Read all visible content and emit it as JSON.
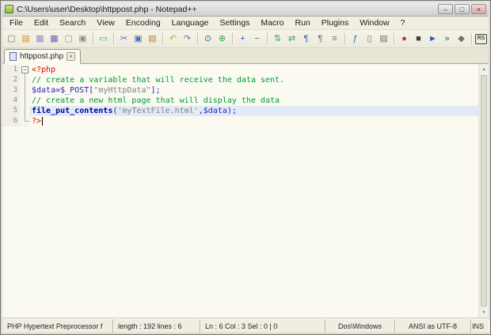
{
  "window": {
    "title": "C:\\Users\\user\\Desktop\\httppost.php - Notepad++",
    "controls": {
      "minimize": "–",
      "maximize": "□",
      "close": "×"
    }
  },
  "menu": {
    "items": [
      "File",
      "Edit",
      "Search",
      "View",
      "Encoding",
      "Language",
      "Settings",
      "Macro",
      "Run",
      "Plugins",
      "Window",
      "?"
    ]
  },
  "toolbar": {
    "icons": [
      {
        "name": "new-file",
        "glyph": "▢",
        "color": "#6f6f6f"
      },
      {
        "name": "open-folder",
        "glyph": "▤",
        "color": "#c89630"
      },
      {
        "name": "save",
        "glyph": "▦",
        "color": "#9a86c8"
      },
      {
        "name": "save-all",
        "glyph": "▦",
        "color": "#6f5fb0"
      },
      {
        "name": "close-file",
        "glyph": "▢",
        "color": "#8f8f8f"
      },
      {
        "name": "close-all-files",
        "glyph": "▣",
        "color": "#8f8f8f"
      },
      {
        "sep": true
      },
      {
        "name": "print",
        "glyph": "▭",
        "color": "#3f9f9f"
      },
      {
        "sep": true
      },
      {
        "name": "cut",
        "glyph": "✂",
        "color": "#4a70b8"
      },
      {
        "name": "copy",
        "glyph": "▣",
        "color": "#4a70b8"
      },
      {
        "name": "paste",
        "glyph": "▤",
        "color": "#b08838"
      },
      {
        "sep": true
      },
      {
        "name": "undo",
        "glyph": "↶",
        "color": "#d0a020"
      },
      {
        "name": "redo",
        "glyph": "↷",
        "color": "#8868c0"
      },
      {
        "sep": true
      },
      {
        "name": "find",
        "glyph": "⊙",
        "color": "#3868b0"
      },
      {
        "name": "replace",
        "glyph": "⊕",
        "color": "#38a068"
      },
      {
        "sep": true
      },
      {
        "name": "zoom-in",
        "glyph": "+",
        "color": "#3868b0"
      },
      {
        "name": "zoom-out",
        "glyph": "−",
        "color": "#3868b0"
      },
      {
        "sep": true
      },
      {
        "name": "sync-vertical-scroll",
        "glyph": "⇅",
        "color": "#3f9f9f"
      },
      {
        "name": "sync-horizontal-scroll",
        "glyph": "⇄",
        "color": "#3f9f9f"
      },
      {
        "name": "word-wrap",
        "glyph": "¶",
        "color": "#3868b0"
      },
      {
        "name": "show-all-characters",
        "glyph": "¶",
        "color": "#707070"
      },
      {
        "name": "show-indent-guide",
        "glyph": "≡",
        "color": "#707070"
      },
      {
        "sep": true
      },
      {
        "name": "function-list",
        "glyph": "ƒ",
        "color": "#3868b0"
      },
      {
        "name": "document-map",
        "glyph": "▯",
        "color": "#707070"
      },
      {
        "name": "document-list",
        "glyph": "▤",
        "color": "#707070"
      },
      {
        "sep": true
      },
      {
        "name": "macro-record",
        "glyph": "●",
        "color": "#c03030"
      },
      {
        "name": "macro-stop",
        "glyph": "■",
        "color": "#404040"
      },
      {
        "name": "macro-play",
        "glyph": "►",
        "color": "#2858b8"
      },
      {
        "name": "macro-run-multiple",
        "glyph": "»",
        "color": "#2858b8"
      },
      {
        "name": "macro-save",
        "glyph": "◆",
        "color": "#707070"
      },
      {
        "sep": true
      },
      {
        "name": "plugin-rs",
        "glyph": "RS",
        "color": "#404040"
      },
      {
        "name": "plugin-doc",
        "glyph": "▣",
        "color": "#3868b0"
      }
    ]
  },
  "tabbar": {
    "tabs": [
      {
        "label": "httppost.php",
        "active": true
      }
    ]
  },
  "editor": {
    "lines": [
      {
        "number": 1,
        "fold": "start",
        "tokens": [
          {
            "t": "<?php",
            "c": "phptag"
          }
        ]
      },
      {
        "number": 2,
        "fold": "mid",
        "tokens": [
          {
            "t": "// create a variable that will receive the data sent.",
            "c": "comment"
          }
        ]
      },
      {
        "number": 3,
        "fold": "mid",
        "tokens": [
          {
            "t": "$data",
            "c": "var"
          },
          {
            "t": "=",
            "c": "op"
          },
          {
            "t": "$_POST",
            "c": "var"
          },
          {
            "t": "[",
            "c": "op"
          },
          {
            "t": "\"myHttpData\"",
            "c": "string"
          },
          {
            "t": "];",
            "c": "op"
          }
        ]
      },
      {
        "number": 4,
        "fold": "mid",
        "tokens": [
          {
            "t": "// create a new html page that will display the data",
            "c": "comment"
          }
        ]
      },
      {
        "number": 5,
        "fold": "mid",
        "highlight": true,
        "tokens": [
          {
            "t": "file_put_contents",
            "c": "func"
          },
          {
            "t": "(",
            "c": "op"
          },
          {
            "t": "'myTextFile.html'",
            "c": "string"
          },
          {
            "t": ",",
            "c": "op"
          },
          {
            "t": "$data",
            "c": "var"
          },
          {
            "t": ");",
            "c": "op"
          }
        ]
      },
      {
        "number": 6,
        "fold": "end",
        "caret": true,
        "tokens": [
          {
            "t": "?>",
            "c": "phptag"
          }
        ]
      }
    ]
  },
  "statusbar": {
    "doctype": "PHP Hypertext Preprocessor f",
    "length_lines": "length : 192    lines : 6",
    "position": "Ln : 6    Col : 3    Sel : 0 | 0",
    "eol": "Dos\\Windows",
    "encoding": "ANSI as UTF-8",
    "insert_mode": "INS"
  }
}
